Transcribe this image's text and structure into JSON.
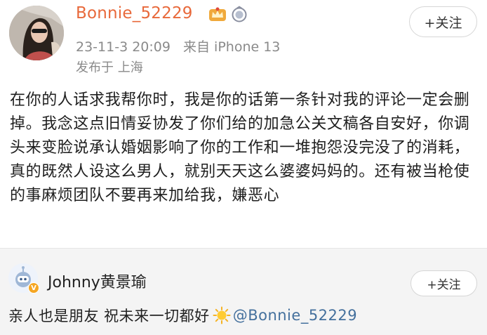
{
  "post": {
    "username": "Bonnie_52229",
    "timestamp": "23-11-3 20:09",
    "source": "来自 iPhone 13",
    "location": "发布于 上海",
    "follow_label": "+关注",
    "text": "在你的人话求我帮你时，我是你的话第一条针对我的评论一定会删掉。我念这点旧情妥协发了你们给的加急公关文稿各自安好，你调头来变脸说承认婚姻影响了你的工作和一堆抱怨没完没了的消耗，真的既然人设这么男人，就别天天这么婆婆妈妈的。还有被当枪使的事麻烦团队不要再来加给我，嫌恶心",
    "accent_color": "#e8693b"
  },
  "repost": {
    "username": "Johnny黄景瑜",
    "follow_label": "+关注",
    "text": "亲人也是朋友 祝未来一切都好",
    "mention": "@Bonnie_52229",
    "mention_color": "#44709d"
  },
  "icons": {
    "post_badges": [
      "crown-badge-icon",
      "membership-ring-icon"
    ],
    "repost_badges": [
      "verified-v-icon"
    ],
    "emoji": "sun-emoji-icon"
  }
}
